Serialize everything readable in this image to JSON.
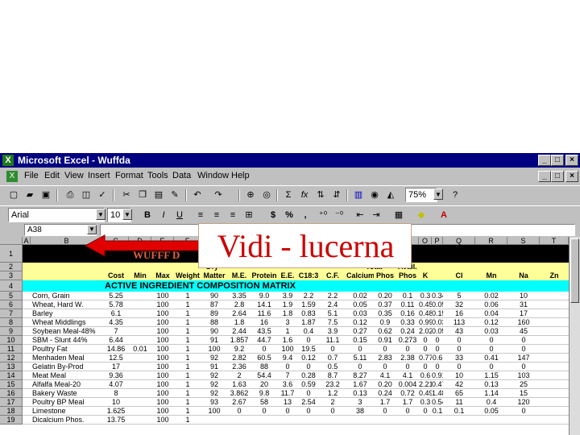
{
  "window": {
    "title": "Microsoft Excel - Wuffda",
    "buttons": {
      "minimize": "_",
      "maximize": "□",
      "close": "×"
    },
    "doc_buttons": {
      "minimize": "_",
      "restore": "□",
      "close": "×"
    }
  },
  "menu": [
    "File",
    "Edit",
    "View",
    "Insert",
    "Format",
    "Tools",
    "Data",
    "Window",
    "Help"
  ],
  "toolbar": {
    "zoom": "75%",
    "font_name": "Arial",
    "font_size": "10",
    "bold": "B",
    "italic": "I",
    "underline": "U",
    "sum": "Σ",
    "fx": "fx",
    "currency": "$",
    "percent": "%",
    "comma": ","
  },
  "name_box": "A38",
  "columns": [
    "A",
    "B",
    "C",
    "D",
    "E",
    "F",
    "G",
    "H",
    "I",
    "J",
    "K",
    "L",
    "M",
    "N",
    "O",
    "P",
    "Q",
    "R",
    "S",
    "T"
  ],
  "sheet": {
    "row1_title": "WUFFF D",
    "header_row2": [
      "Cost",
      "Min",
      "Max",
      "Weight",
      "Matter",
      "M.E.",
      "Protein",
      "E.E.",
      "C18:3",
      "C.F.",
      "Calcium",
      "Phos",
      "Phos",
      "K",
      "Cl",
      "Mn",
      "Na",
      "Zn"
    ],
    "header_row2_top": [
      "Dry",
      "Total",
      "Avail."
    ],
    "section_title": "ACTIVE INGREDIENT COMPOSITION MATRIX",
    "row_numbers": [
      "1",
      "2",
      "3",
      "4",
      "5",
      "6",
      "7",
      "8",
      "9",
      "10",
      "11",
      "12",
      "13",
      "14",
      "15",
      "16",
      "17",
      "18",
      "19"
    ],
    "rows": [
      [
        "Corn, Grain",
        "5.25",
        "",
        "100",
        "1",
        "90",
        "3.35",
        "9.0",
        "3.9",
        "2.2",
        "2.2",
        "0.02",
        "0.20",
        "0.1",
        "0.3",
        "0.34",
        "5",
        "0.02",
        "10"
      ],
      [
        "Wheat, Hard W.",
        "5.78",
        "",
        "100",
        "1",
        "87",
        "2.8",
        "14.1",
        "1.9",
        "1.59",
        "2.4",
        "0.05",
        "0.37",
        "0.11",
        "0.45",
        "0.05",
        "32",
        "0.06",
        "31"
      ],
      [
        "Barley",
        "6.1",
        "",
        "100",
        "1",
        "89",
        "2.64",
        "11.6",
        "1.8",
        "0.83",
        "5.1",
        "0.03",
        "0.35",
        "0.16",
        "0.48",
        "0.15",
        "16",
        "0.04",
        "17"
      ],
      [
        "Wheat Middlings",
        "4.35",
        "",
        "100",
        "1",
        "88",
        "1.8",
        "16",
        "3",
        "1.87",
        "7.5",
        "0.12",
        "0.9",
        "0.33",
        "0.99",
        "0.03",
        "113",
        "0.12",
        "160"
      ],
      [
        "Soybean Meal-48%",
        "7",
        "",
        "100",
        "1",
        "90",
        "2.44",
        "43.5",
        "1",
        "0.4",
        "3.9",
        "0.27",
        "0.62",
        "0.24",
        "2.02",
        "0.05",
        "43",
        "0.03",
        "45"
      ],
      [
        "SBM - Slunt 44%",
        "6.44",
        "",
        "100",
        "1",
        "91",
        "1.857",
        "44.7",
        "1.6",
        "0",
        "11.1",
        "0.15",
        "0.91",
        "0.273",
        "0",
        "0",
        "0",
        "0",
        "0"
      ],
      [
        "Poultry Fat",
        "14.86",
        "0.01",
        "100",
        "1",
        "100",
        "9.2",
        "0",
        "100",
        "19.5",
        "0",
        "0",
        "0",
        "0",
        "0",
        "0",
        "0",
        "0",
        "0"
      ],
      [
        "Menhaden Meal",
        "12.5",
        "",
        "100",
        "1",
        "92",
        "2.82",
        "60.5",
        "9.4",
        "0.12",
        "0.7",
        "5.11",
        "2.83",
        "2.38",
        "0.77",
        "0.6",
        "33",
        "0.41",
        "147"
      ],
      [
        "Gelatin By-Prod",
        "17",
        "",
        "100",
        "1",
        "91",
        "2.36",
        "88",
        "0",
        "0",
        "0.5",
        "0",
        "0",
        "0",
        "0",
        "0",
        "0",
        "0",
        "0"
      ],
      [
        "Meat Meal",
        "9.36",
        "",
        "100",
        "1",
        "92",
        "2",
        "54.4",
        "7",
        "0.28",
        "8.7",
        "8.27",
        "4.1",
        "4.1",
        "0.6",
        "0.91",
        "10",
        "1.15",
        "103"
      ],
      [
        "Alfalfa Meal-20",
        "4.07",
        "",
        "100",
        "1",
        "92",
        "1.63",
        "20",
        "3.6",
        "0.59",
        "23.2",
        "1.67",
        "0.20",
        "0.004",
        "2.21",
        "0.47",
        "42",
        "0.13",
        "25"
      ],
      [
        "Bakery Waste",
        "8",
        "",
        "100",
        "1",
        "92",
        "3.862",
        "9.8",
        "11.7",
        "0",
        "1.2",
        "0.13",
        "0.24",
        "0.72",
        "0.49",
        "1.48",
        "65",
        "1.14",
        "15"
      ],
      [
        "Poultry BP Meal",
        "10",
        "",
        "100",
        "1",
        "93",
        "2.67",
        "58",
        "13",
        "2.54",
        "2",
        "3",
        "1.7",
        "1.7",
        "0.3",
        "0.54",
        "11",
        "0.4",
        "120"
      ],
      [
        "Limestone",
        "1.625",
        "",
        "100",
        "1",
        "100",
        "0",
        "0",
        "0",
        "0",
        "0",
        "38",
        "0",
        "0",
        "0",
        "0.1",
        "0.1",
        "0.05",
        "0"
      ],
      [
        "Dicalcium Phos.",
        "13.75",
        "",
        "100",
        "1",
        "",
        "",
        "",
        "",
        "",
        "",
        "",
        "",
        "",
        "",
        "",
        "",
        "",
        ""
      ]
    ]
  },
  "callout": {
    "text": "Vidi - lucerna"
  },
  "colors": {
    "title_bar": "#000080",
    "chrome": "#c0c0c0",
    "band_black": "#000000",
    "band_yellow": "#ffff99",
    "band_cyan": "#00ffff",
    "callout_text": "#cc0000",
    "arrow": "#e00000"
  }
}
